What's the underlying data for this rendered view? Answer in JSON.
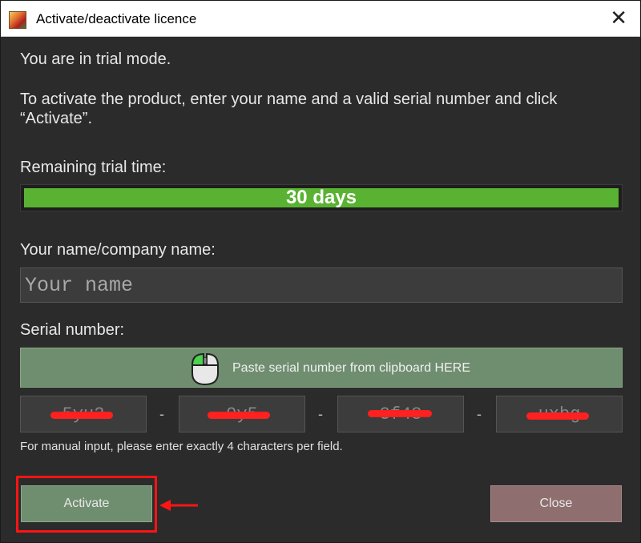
{
  "window": {
    "title": "Activate/deactivate licence",
    "close_glyph": "✕",
    "app_icon": "app-logo-icon"
  },
  "status_text": "You are in trial mode.",
  "instructions": "To activate the product, enter your name and a valid serial number and click “Activate”.",
  "trial": {
    "label": "Remaining trial time:",
    "value_text": "30 days",
    "fill_fraction": 1.0,
    "color": "#5ab232"
  },
  "name": {
    "label": "Your name/company name:",
    "placeholder": "Your name"
  },
  "serial": {
    "label": "Serial number:",
    "paste_button_label": "Paste serial number from clipboard HERE",
    "paste_icon": "mouse-icon",
    "fields": [
      "5yu2",
      "9y5",
      "3f48",
      "uxbg"
    ],
    "separator": "-",
    "hint": "For manual input, please enter exactly 4 characters per field."
  },
  "buttons": {
    "activate_label": "Activate",
    "close_label": "Close"
  },
  "colors": {
    "accent_green": "#6f8e6f",
    "close_red": "#8e6e6e",
    "annotation_red": "#ff1414"
  }
}
